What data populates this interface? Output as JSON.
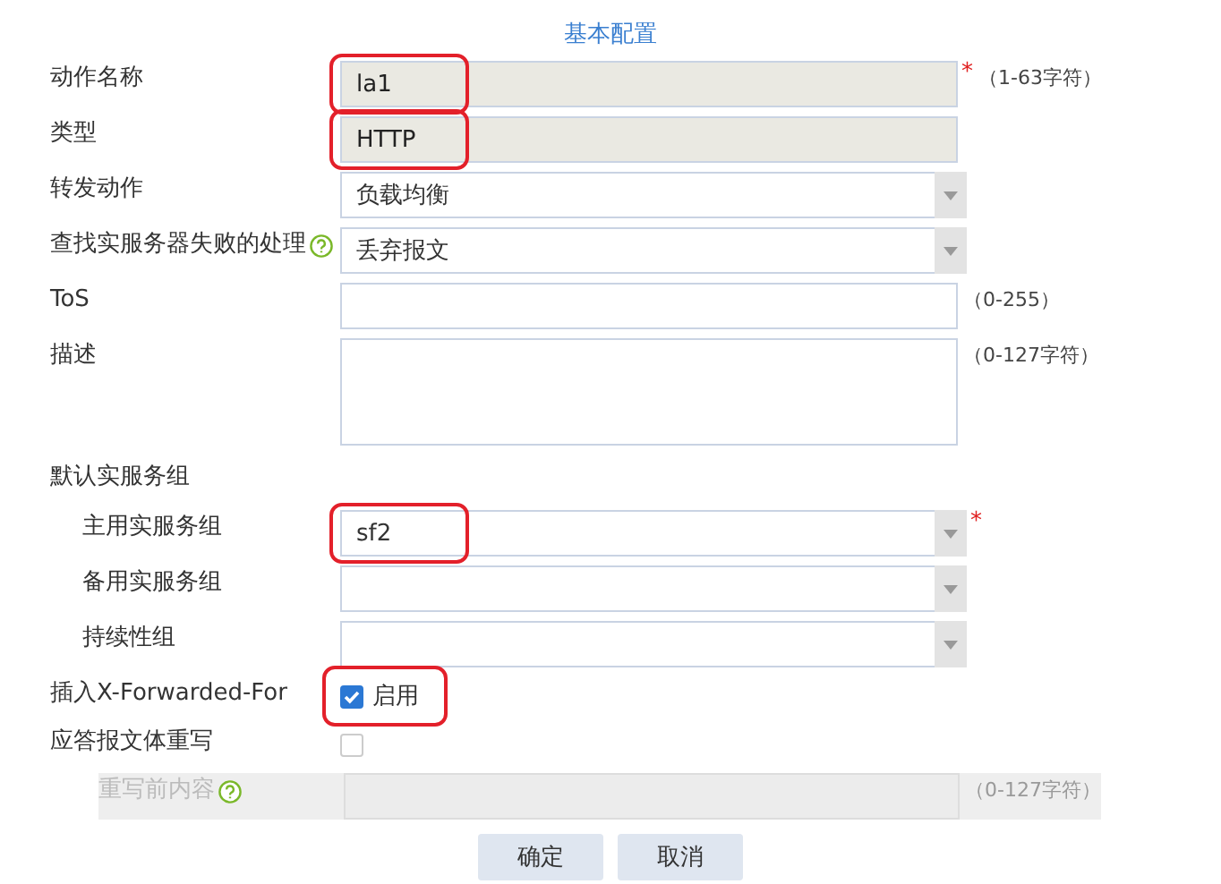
{
  "title": "基本配置",
  "rows": [
    {
      "kind": "text",
      "label": "动作名称",
      "value": "la1",
      "required_mark": "*",
      "hint": "（1-63字符）",
      "circled": true
    },
    {
      "kind": "text",
      "label": "类型",
      "value": "HTTP",
      "circled": true
    },
    {
      "kind": "select",
      "label": "转发动作",
      "value": "负载均衡"
    },
    {
      "kind": "select",
      "label": "查找实服务器失败的处理",
      "help": true,
      "value": "丢弃报文"
    },
    {
      "kind": "input",
      "label": "ToS",
      "hint": "（0-255）"
    },
    {
      "kind": "textarea",
      "label": "描述",
      "hint": "（0-127字符）"
    },
    {
      "kind": "heading",
      "label": "默认实服务组"
    },
    {
      "kind": "select",
      "label": "主用实服务组",
      "indent": true,
      "value": "sf2",
      "required_mark": "*",
      "circled": true
    },
    {
      "kind": "select",
      "label": "备用实服务组",
      "indent": true
    },
    {
      "kind": "select",
      "label": "持续性组",
      "indent": true
    },
    {
      "kind": "checkbox",
      "label": "插入X-Forwarded-For",
      "checked": true,
      "option": "启用",
      "circled": true
    },
    {
      "kind": "checkbox",
      "label": "应答报文体重写",
      "checked": false
    },
    {
      "kind": "input",
      "label": "重写前内容",
      "indent": true,
      "help": true,
      "disabled": true,
      "hint": "（0-127字符）"
    }
  ],
  "buttons": [
    "确定",
    "取消"
  ]
}
